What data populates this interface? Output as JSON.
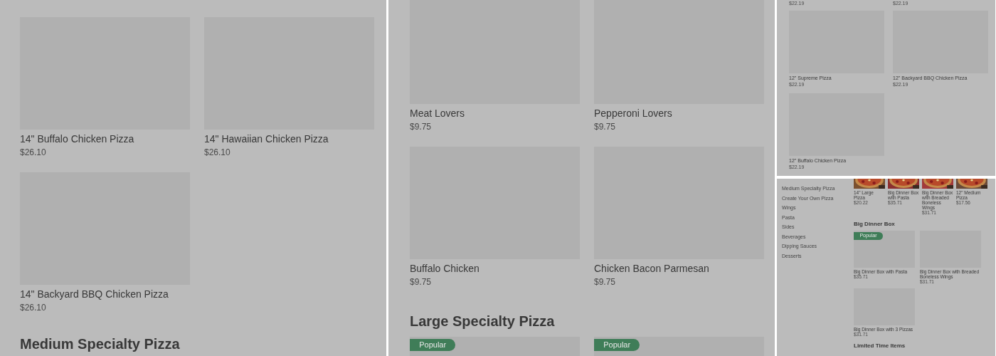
{
  "panels": [
    {
      "blocks": [
        {
          "kind": "cards",
          "items": [
            {
              "name": "14\" Buffalo Chicken Pizza",
              "price": "$26.10"
            },
            {
              "name": "14\" Hawaiian Chicken Pizza",
              "price": "$26.10"
            },
            {
              "name": "14\" Backyard BBQ Chicken Pizza",
              "price": "$26.10"
            }
          ]
        },
        {
          "kind": "heading",
          "text": "Medium Specialty Pizza"
        }
      ]
    },
    {
      "blocks": [
        {
          "kind": "cards",
          "items": [
            {
              "name": "Meat Lovers",
              "price": "$9.75"
            },
            {
              "name": "Pepperoni Lovers",
              "price": "$9.75"
            },
            {
              "name": "Buffalo Chicken",
              "price": "$9.75"
            },
            {
              "name": "Chicken Bacon Parmesan",
              "price": "$9.75"
            }
          ]
        },
        {
          "kind": "heading",
          "text": "Large Specialty Pizza"
        },
        {
          "kind": "cards",
          "items": [
            {
              "badge": "Popular"
            },
            {
              "badge": "Popular"
            }
          ]
        }
      ]
    },
    {
      "blocks": [
        {
          "kind": "prices",
          "items": [
            "$22.19",
            "$22.19"
          ]
        },
        {
          "kind": "cards",
          "items": [
            {
              "name": "12\" Supreme Pizza",
              "price": "$22.19"
            },
            {
              "name": "12\" Backyard BBQ Chicken Pizza",
              "price": "$22.19"
            },
            {
              "name": "12\" Buffalo Chicken Pizza",
              "price": "$22.19"
            }
          ]
        }
      ]
    },
    {
      "sidebar": [
        "Medium Specialty Pizza",
        "Create Your Own Pizza",
        "Wings",
        "Pasta",
        "Sides",
        "Beverages",
        "Dipping Sauces",
        "Desserts"
      ],
      "blocks": [
        {
          "kind": "carousel",
          "items": [
            {
              "name": "14\" Large Pizza",
              "price": "$20.22"
            },
            {
              "name": "Big Dinner Box with Pasta",
              "price": "$35.71"
            },
            {
              "name": "Big Dinner Box with Breaded Boneless Wings",
              "price": "$31.71"
            },
            {
              "name": "12\" Medium Pizza",
              "price": "$17.56"
            }
          ]
        },
        {
          "kind": "heading",
          "text": "Big Dinner Box"
        },
        {
          "kind": "cards",
          "items": [
            {
              "badge": "Popular",
              "name": "Big Dinner Box with Pasta",
              "price": "$35.71"
            },
            {
              "name": "Big Dinner Box with Breaded Boneless Wings",
              "price": "$31.71"
            },
            {
              "name": "Big Dinner Box with 3 Pizzas",
              "price": "$31.71"
            }
          ]
        },
        {
          "kind": "heading",
          "text": "Limited Time Items"
        }
      ]
    }
  ]
}
